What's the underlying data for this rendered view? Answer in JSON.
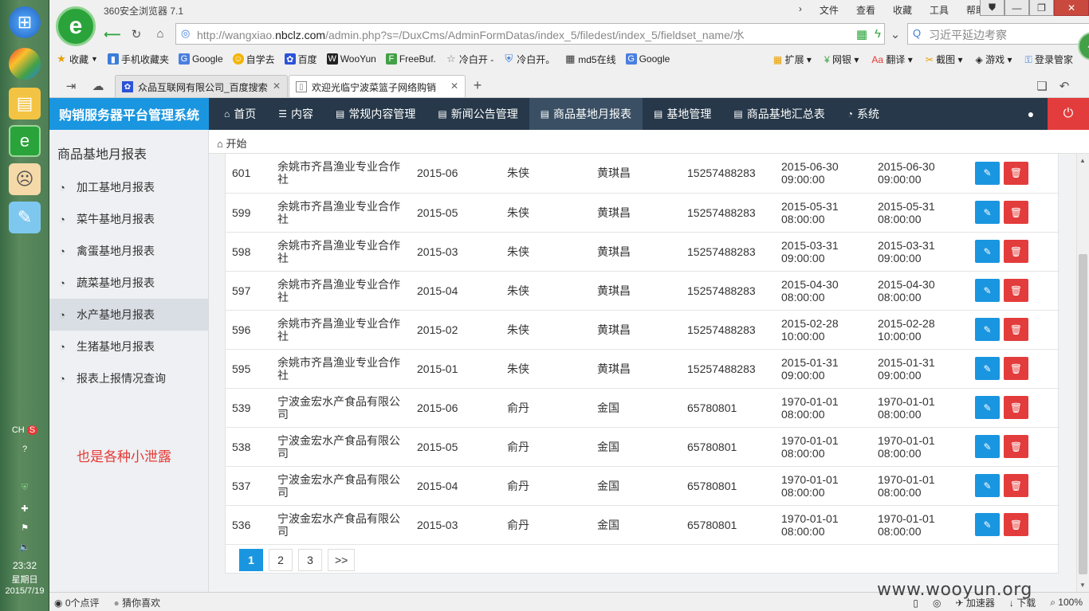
{
  "os": {
    "tray_lang": "CH",
    "time": "23:32",
    "weekday": "星期日",
    "date": "2015/7/19"
  },
  "browser": {
    "title": "360安全浏览器 7.1",
    "menu": [
      "文件",
      "查看",
      "收藏",
      "工具",
      "帮助"
    ],
    "url_prefix": "http://wangxiao.",
    "url_domain": "nbclz.com",
    "url_path": "/admin.php?s=/DuxCms/AdminFormDatas/index_5/filedest/index_5/fieldset_name/水",
    "search_placeholder": "习近平延边考察",
    "badge": "48",
    "favorites": [
      {
        "label": "收藏",
        "icon": "star-icon",
        "color": "#e8a000"
      },
      {
        "label": "手机收藏夹",
        "icon": "phone-icon",
        "color": "#3b7dd8"
      },
      {
        "label": "Google",
        "icon": "google-icon",
        "color": "#4a7fe0"
      },
      {
        "label": "自学去",
        "icon": "smile-icon",
        "color": "#f2b400"
      },
      {
        "label": "百度",
        "icon": "baidu-icon",
        "color": "#2b52d8"
      },
      {
        "label": "WooYun",
        "icon": "wooyun-icon",
        "color": "#222222"
      },
      {
        "label": "FreeBuf.",
        "icon": "freebuf-icon",
        "color": "#43a047"
      },
      {
        "label": "冷白开 -",
        "icon": "home-icon",
        "color": "#777777"
      },
      {
        "label": "冷白开。",
        "icon": "shield-icon",
        "color": "#3b7dd8"
      },
      {
        "label": "md5在线",
        "icon": "grid-icon",
        "color": "#333333"
      },
      {
        "label": "Google",
        "icon": "google-icon",
        "color": "#4a7fe0"
      }
    ],
    "fav_tools": [
      "扩展",
      "网银",
      "翻译",
      "截图",
      "游戏",
      "登录管家"
    ],
    "tabs": [
      {
        "label": "众品互联网有限公司_百度搜索"
      },
      {
        "label": "欢迎光临宁波菜篮子网络购销"
      }
    ],
    "status_left": [
      "0个点评",
      "猜你喜欢"
    ],
    "status_right": [
      "加速器",
      "下载",
      "100%"
    ],
    "watermark": "www.wooyun.org"
  },
  "app": {
    "brand": "购销服务器平台管理系统",
    "nav": [
      {
        "label": "首页",
        "icon": "home-icon"
      },
      {
        "label": "内容",
        "icon": "menu-icon"
      },
      {
        "label": "常规内容管理",
        "icon": "file-icon"
      },
      {
        "label": "新闻公告管理",
        "icon": "file-icon"
      },
      {
        "label": "商品基地月报表",
        "icon": "file-icon"
      },
      {
        "label": "基地管理",
        "icon": "file-icon"
      },
      {
        "label": "商品基地汇总表",
        "icon": "file-icon"
      },
      {
        "label": "系统",
        "icon": "gauge-icon"
      }
    ],
    "breadcrumb": "开始",
    "sidebar": {
      "title": "商品基地月报表",
      "items": [
        {
          "label": "加工基地月报表"
        },
        {
          "label": "菜牛基地月报表"
        },
        {
          "label": "禽蛋基地月报表"
        },
        {
          "label": "蔬菜基地月报表"
        },
        {
          "label": "水产基地月报表"
        },
        {
          "label": "生猪基地月报表"
        },
        {
          "label": "报表上报情况查询"
        }
      ],
      "note": "也是各种小泄露"
    },
    "rows": [
      {
        "id": "601",
        "company": "余姚市齐昌渔业专业合作社",
        "month": "2015-06",
        "reporter": "朱侠",
        "contact": "黄琪昌",
        "phone": "15257488283",
        "created_date": "2015-06-30",
        "created_time": "09:00:00",
        "updated_date": "2015-06-30",
        "updated_time": "09:00:00"
      },
      {
        "id": "599",
        "company": "余姚市齐昌渔业专业合作社",
        "month": "2015-05",
        "reporter": "朱侠",
        "contact": "黄琪昌",
        "phone": "15257488283",
        "created_date": "2015-05-31",
        "created_time": "08:00:00",
        "updated_date": "2015-05-31",
        "updated_time": "08:00:00"
      },
      {
        "id": "598",
        "company": "余姚市齐昌渔业专业合作社",
        "month": "2015-03",
        "reporter": "朱侠",
        "contact": "黄琪昌",
        "phone": "15257488283",
        "created_date": "2015-03-31",
        "created_time": "09:00:00",
        "updated_date": "2015-03-31",
        "updated_time": "09:00:00"
      },
      {
        "id": "597",
        "company": "余姚市齐昌渔业专业合作社",
        "month": "2015-04",
        "reporter": "朱侠",
        "contact": "黄琪昌",
        "phone": "15257488283",
        "created_date": "2015-04-30",
        "created_time": "08:00:00",
        "updated_date": "2015-04-30",
        "updated_time": "08:00:00"
      },
      {
        "id": "596",
        "company": "余姚市齐昌渔业专业合作社",
        "month": "2015-02",
        "reporter": "朱侠",
        "contact": "黄琪昌",
        "phone": "15257488283",
        "created_date": "2015-02-28",
        "created_time": "10:00:00",
        "updated_date": "2015-02-28",
        "updated_time": "10:00:00"
      },
      {
        "id": "595",
        "company": "余姚市齐昌渔业专业合作社",
        "month": "2015-01",
        "reporter": "朱侠",
        "contact": "黄琪昌",
        "phone": "15257488283",
        "created_date": "2015-01-31",
        "created_time": "09:00:00",
        "updated_date": "2015-01-31",
        "updated_time": "09:00:00"
      },
      {
        "id": "539",
        "company": "宁波金宏水产食品有限公司",
        "month": "2015-06",
        "reporter": "俞丹",
        "contact": "金国",
        "phone": "65780801",
        "created_date": "1970-01-01",
        "created_time": "08:00:00",
        "updated_date": "1970-01-01",
        "updated_time": "08:00:00"
      },
      {
        "id": "538",
        "company": "宁波金宏水产食品有限公司",
        "month": "2015-05",
        "reporter": "俞丹",
        "contact": "金国",
        "phone": "65780801",
        "created_date": "1970-01-01",
        "created_time": "08:00:00",
        "updated_date": "1970-01-01",
        "updated_time": "08:00:00"
      },
      {
        "id": "537",
        "company": "宁波金宏水产食品有限公司",
        "month": "2015-04",
        "reporter": "俞丹",
        "contact": "金国",
        "phone": "65780801",
        "created_date": "1970-01-01",
        "created_time": "08:00:00",
        "updated_date": "1970-01-01",
        "updated_time": "08:00:00"
      },
      {
        "id": "536",
        "company": "宁波金宏水产食品有限公司",
        "month": "2015-03",
        "reporter": "俞丹",
        "contact": "金国",
        "phone": "65780801",
        "created_date": "1970-01-01",
        "created_time": "08:00:00",
        "updated_date": "1970-01-01",
        "updated_time": "08:00:00"
      }
    ],
    "pager": [
      "1",
      "2",
      "3",
      ">>"
    ],
    "colors": {
      "header": "#263849",
      "brand": "#1a96e0",
      "danger": "#e33c3c",
      "sidebar": "#eef0f3"
    }
  }
}
